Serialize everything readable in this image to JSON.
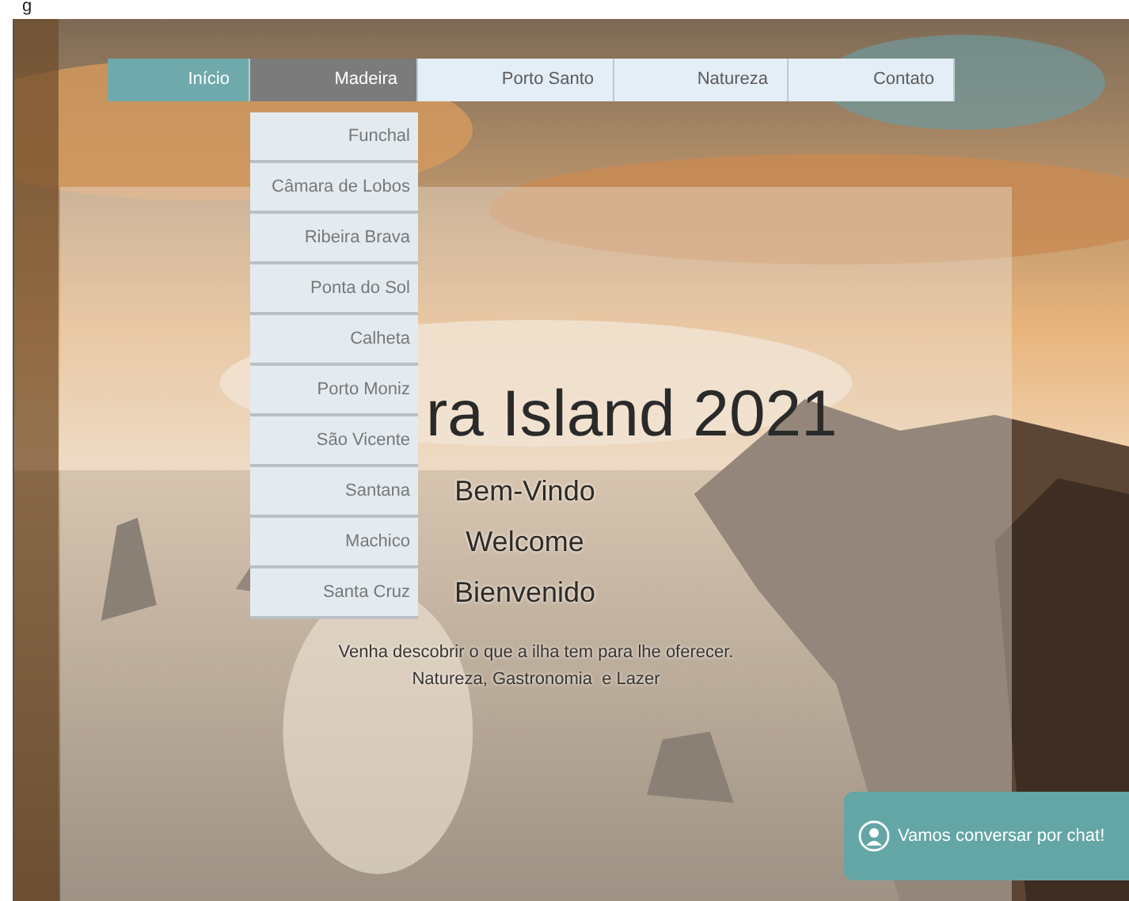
{
  "top_fragment": "g",
  "nav": [
    {
      "label": "Início",
      "kind": "home",
      "selected": false
    },
    {
      "label": "Madeira",
      "kind": "item",
      "selected": true
    },
    {
      "label": "Porto Santo",
      "kind": "item",
      "selected": false
    },
    {
      "label": "Natureza",
      "kind": "item",
      "selected": false
    },
    {
      "label": "Contato",
      "kind": "item",
      "selected": false
    }
  ],
  "dropdown": [
    "Funchal",
    "Câmara de Lobos",
    "Ribeira Brava",
    "Ponta do Sol",
    "Calheta",
    "Porto Moniz",
    "São Vicente",
    "Santana",
    "Machico",
    "Santa Cruz"
  ],
  "hero": {
    "title": "ra Island 2021",
    "greetings": [
      "Bem-Vindo",
      "Welcome",
      "Bienvenido"
    ],
    "tagline": [
      "Venha descobrir o que a ilha tem para lhe oferecer.",
      "Natureza, Gastronomia  e Lazer"
    ]
  },
  "chat": {
    "label": "Vamos conversar por chat!"
  }
}
